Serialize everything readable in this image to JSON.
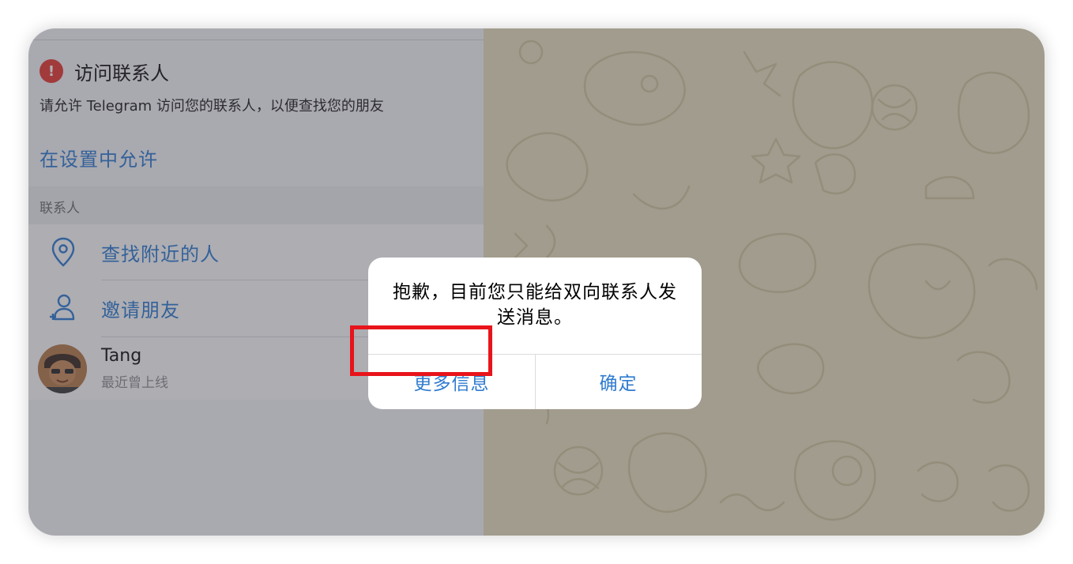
{
  "permission": {
    "title": "访问联系人",
    "warning_icon": "!",
    "description": "请允许 Telegram 访问您的联系人，以便查找您的朋友",
    "allow_link": "在设置中允许"
  },
  "contacts_section": {
    "header": "联系人",
    "actions": [
      {
        "label": "查找附近的人",
        "icon": "location-pin-icon"
      },
      {
        "label": "邀请朋友",
        "icon": "add-person-icon"
      }
    ],
    "contacts": [
      {
        "name": "Tang",
        "status": "最近曾上线"
      }
    ]
  },
  "alert": {
    "message": "抱歉，目前您只能给双向联系人发送消息。",
    "buttons": {
      "more_info": "更多信息",
      "ok": "确定"
    }
  },
  "colors": {
    "link_blue": "#2f7bd0",
    "warning_red": "#e53935",
    "highlight_red": "#e8141b",
    "wallpaper": "#e4dcbd"
  }
}
